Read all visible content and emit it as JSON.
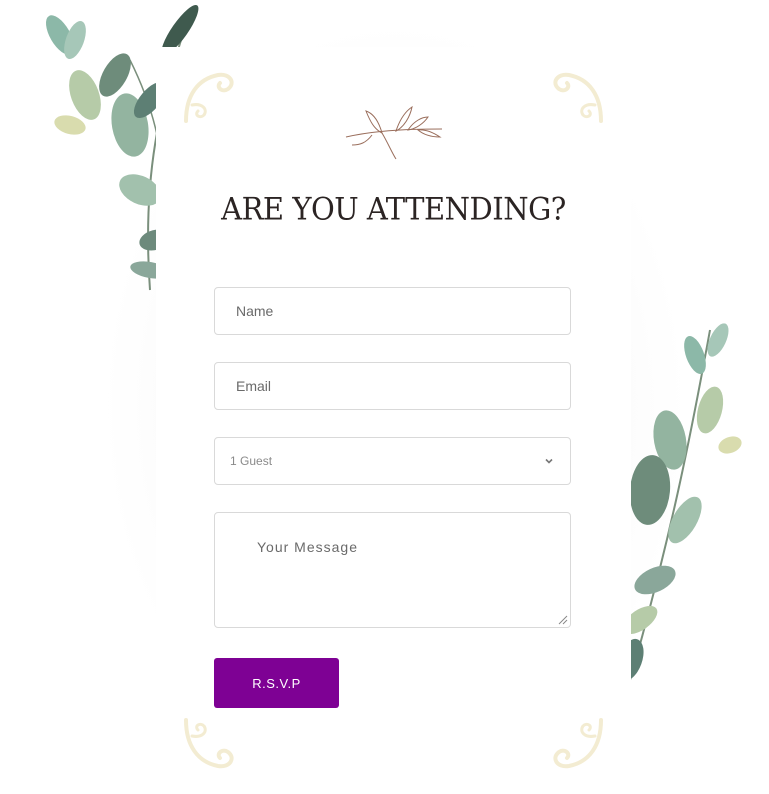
{
  "heading": "ARE YOU ATTENDING?",
  "form": {
    "name_placeholder": "Name",
    "email_placeholder": "Email",
    "guests_selected": "1 Guest",
    "message_placeholder": "Your Message",
    "submit_label": "R.S.V.P"
  },
  "colors": {
    "accent": "#7e0194",
    "heading": "#2b2423",
    "ornament": "#f3ecd2",
    "leaf_green": "#8fb5a0"
  },
  "icons": {
    "dropdown": "chevron-down-icon",
    "decor_top": "floral-sprig-icon",
    "corners": "flourish-ornament-icon"
  }
}
